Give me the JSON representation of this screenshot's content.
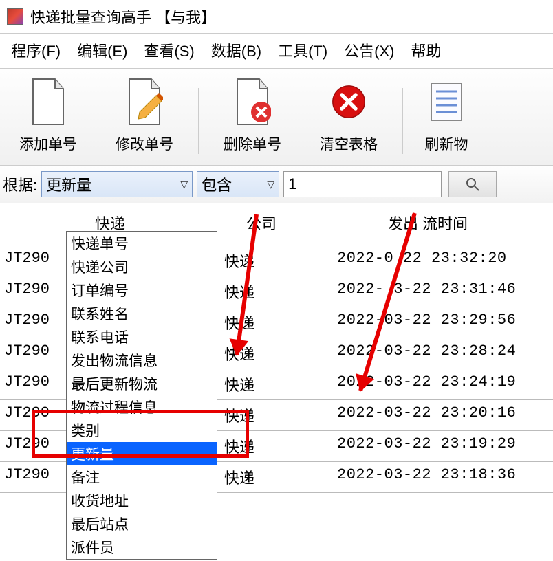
{
  "app": {
    "title": "快递批量查询高手 【与我】"
  },
  "menu": {
    "items": [
      "程序(F)",
      "编辑(E)",
      "查看(S)",
      "数据(B)",
      "工具(T)",
      "公告(X)",
      "帮助"
    ]
  },
  "toolbar": {
    "items": [
      "添加单号",
      "修改单号",
      "删除单号",
      "清空表格",
      "刷新物"
    ]
  },
  "filter": {
    "label": "根据:",
    "field_value": "更新量",
    "op_value": "包含",
    "text_value": "1"
  },
  "dropdown": {
    "items": [
      "快递单号",
      "快递公司",
      "订单编号",
      "联系姓名",
      "联系电话",
      "发出物流信息",
      "最后更新物流",
      "物流过程信息",
      "类别",
      "更新量",
      "备注",
      "收货地址",
      "最后站点",
      "派件员"
    ],
    "selected_index": 9
  },
  "table": {
    "headers": {
      "h1": "快递",
      "h2": "公司",
      "h3": "发出    流时间"
    },
    "col2_text": "快递",
    "rows": [
      {
        "id": "JT290",
        "time": "2022-0   22 23:32:20"
      },
      {
        "id": "JT290",
        "time": "2022-   3-22 23:31:46"
      },
      {
        "id": "JT290",
        "time": "2022-03-22 23:29:56"
      },
      {
        "id": "JT290",
        "time": "2022-03-22 23:28:24"
      },
      {
        "id": "JT290",
        "time": "2022-03-22 23:24:19"
      },
      {
        "id": "JT290",
        "time": "2022-03-22 23:20:16"
      },
      {
        "id": "JT290",
        "time": "2022-03-22 23:19:29"
      },
      {
        "id": "JT290",
        "time": "2022-03-22 23:18:36"
      }
    ]
  }
}
